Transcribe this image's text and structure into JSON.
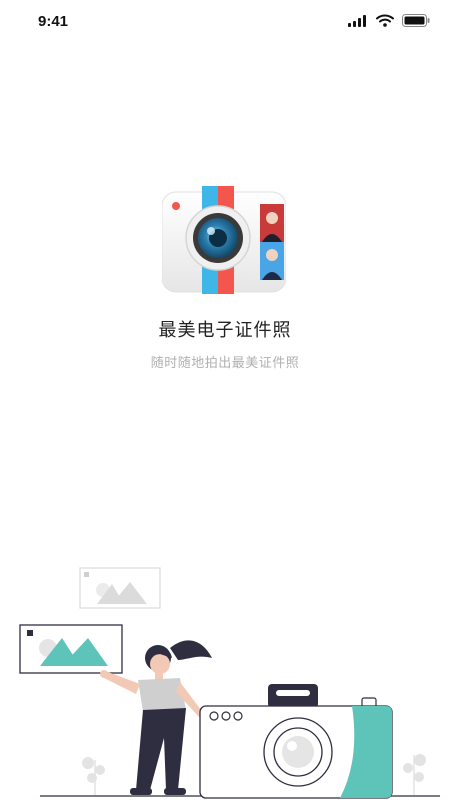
{
  "status_bar": {
    "time": "9:41",
    "icons": [
      "signal-icon",
      "wifi-icon",
      "battery-icon"
    ]
  },
  "app": {
    "title": "最美电子证件照",
    "subtitle": "随时随地拍出最美证件照",
    "logo_icon": "camera-id-photo-logo"
  },
  "illustration": {
    "description_icon": "woman-with-camera-illustration"
  },
  "colors": {
    "accent_teal": "#5ec3b8",
    "accent_red": "#f25c54",
    "accent_blue": "#3aa4e0",
    "dark": "#2f2e41"
  }
}
